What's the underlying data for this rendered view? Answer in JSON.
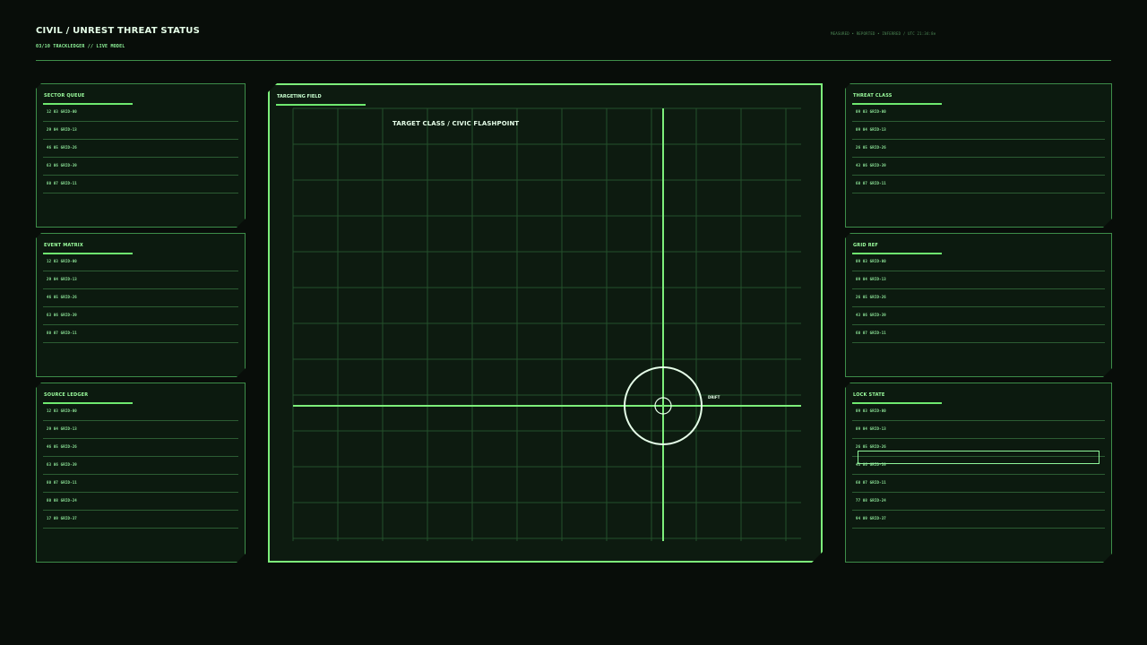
{
  "header": {
    "title": "CIVIL / UNREST THREAT STATUS",
    "subtitle": "03/10  TRACKLEDGER  //  LIVE MODEL",
    "legend_note": "MEASURED • REPORTED • INFERRED / UTC 21:34:8e"
  },
  "left_panels": [
    {
      "title": "SECTOR QUEUE",
      "rows": [
        "12 03 GRID-00",
        "29 04 GRID-13",
        "46 05 GRID-26",
        "63 06 GRID-39",
        "80 07 GRID-11"
      ]
    },
    {
      "title": "EVENT MATRIX",
      "rows": [
        "12 03 GRID-00",
        "29 04 GRID-13",
        "46 05 GRID-26",
        "63 06 GRID-39",
        "80 07 GRID-11"
      ]
    },
    {
      "title": "SOURCE LEDGER",
      "rows": [
        "12 03 GRID-00",
        "29 04 GRID-13",
        "46 05 GRID-26",
        "63 06 GRID-39",
        "80 07 GRID-11",
        "80 08 GRID-24",
        "17 09 GRID-37"
      ]
    }
  ],
  "right_panels": [
    {
      "title": "THREAT CLASS",
      "rows": [
        "09 03 GRID-00",
        "09 04 GRID-13",
        "26 05 GRID-26",
        "43 06 GRID-39",
        "60 07 GRID-11"
      ]
    },
    {
      "title": "GRID REF",
      "rows": [
        "09 03 GRID-00",
        "09 04 GRID-13",
        "26 05 GRID-26",
        "43 06 GRID-39",
        "60 07 GRID-11"
      ]
    },
    {
      "title": "LOCK STATE",
      "rows": [
        "09 03 GRID-00",
        "09 04 GRID-13",
        "26 05 GRID-26",
        "43 06 GRID-39",
        "60 07 GRID-11",
        "77 08 GRID-24",
        "94 09 GRID-37"
      ],
      "locked_row": 2
    }
  ],
  "targeting": {
    "title": "TARGETING FIELD",
    "target_label": "TARGET CLASS / CIVIC FLASHPOINT",
    "drift_label": "DRIFT"
  },
  "colors": {
    "background": "#080d09",
    "panel": "#0c1a0f",
    "accent": "#7dee7b",
    "text_bright": "#e6ffe9",
    "text_green": "#8fe79a"
  }
}
